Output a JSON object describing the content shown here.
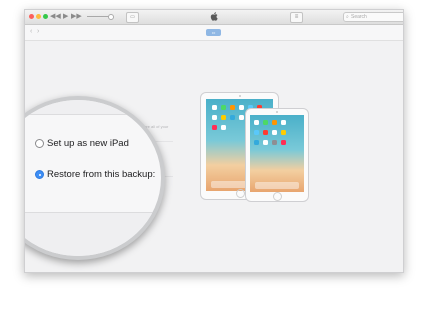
{
  "toolbar": {
    "back_glyph": "◀◀",
    "play_glyph": "▶",
    "forward_glyph": "▶▶",
    "airplay_icon": "airplay-icon",
    "list_icon": "list-icon"
  },
  "search": {
    "placeholder": "Search",
    "icon": "search-icon"
  },
  "navbar": {
    "back_arrow": "‹",
    "forward_arrow": "›"
  },
  "restore_panel": {
    "faint_caption": "to restore all of your"
  },
  "options": [
    {
      "label": "Set up as new iPad",
      "selected": false
    },
    {
      "label": "Restore from this backup:",
      "selected": true
    }
  ],
  "colors": {
    "accent": "#3d8ef5",
    "traffic_red": "#fc605c",
    "traffic_yellow": "#fdbc40",
    "traffic_green": "#34c84a"
  }
}
